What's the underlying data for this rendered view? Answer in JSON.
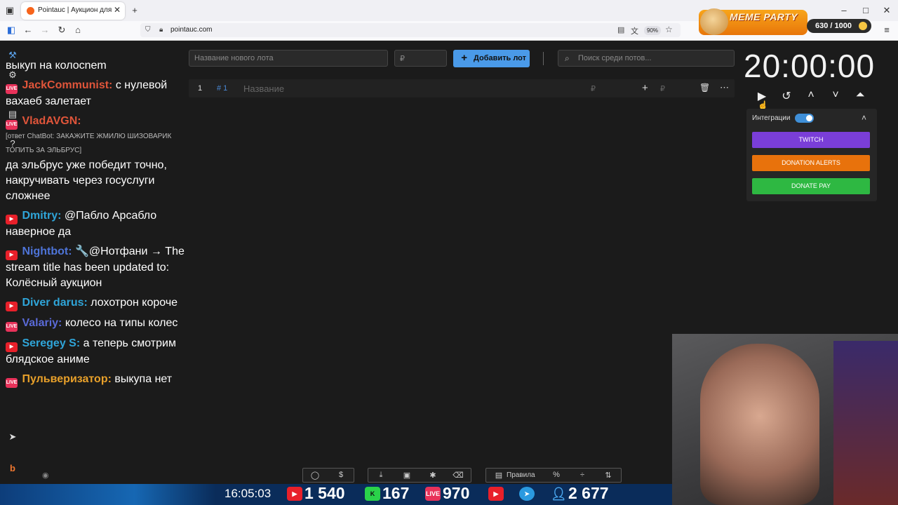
{
  "browser": {
    "tab_title": "Pointauc | Аукцион для стриме",
    "url": "pointauc.com",
    "zoom": "90%"
  },
  "overlay": {
    "meme_title": "MEME PARTY",
    "meme_count": "630 / 1000"
  },
  "chat": {
    "messages": [
      {
        "user": "",
        "text": "выкуп на колосnem"
      },
      {
        "user": "JackCommunist:",
        "text": "с нулевой вахаеб залетает",
        "color": "#e0553a"
      },
      {
        "user": "VladAVGN:",
        "text": "",
        "color": "#e0553a"
      },
      {
        "reply": "[ответ ChatBot: ЗАКАЖИТЕ ЖМИЛЮ ШИЗОВАРИК ТОПИТЬ ЗА ЭЛЬБРУС]"
      },
      {
        "user": "",
        "text": "да эльбрус уже победит точно, накручивать через госуслуги сложнее"
      },
      {
        "user": "Dmitry:",
        "text": "@Пабло Арсабло наверное да",
        "color": "#2fa5d9"
      },
      {
        "user": "Nightbot:",
        "text": "🔧@Нотфани → The stream title has been updated to: Колёсный аукцион",
        "color": "#4e74d8"
      },
      {
        "user": "Diver darus:",
        "text": "лохотрон короче",
        "color": "#2fa5d9"
      },
      {
        "user": "Valariy:",
        "text": "колесо на типы колес",
        "color": "#5a6ad8"
      },
      {
        "user": "Seregey S:",
        "text": "а теперь смотрим блядское аниме",
        "color": "#2fa5d9"
      },
      {
        "user": "Пульверизатор:",
        "text": "выкупа нет",
        "color": "#e8a02a"
      }
    ]
  },
  "lot_form": {
    "name_placeholder": "Название нового лота",
    "amount_placeholder": "₽",
    "add_button": "Добавить лот",
    "search_placeholder": "Поиск среди потов..."
  },
  "lot_row": {
    "index": "1",
    "id": "# 1",
    "name_placeholder": "Название",
    "amount_placeholder": "₽",
    "add_placeholder": "₽"
  },
  "timer": {
    "value": "20:00:00"
  },
  "integrations": {
    "label": "Интеграции",
    "twitch": "TWITCH",
    "donation_alerts": "DONATION ALERTS",
    "donate_pay": "DONATE PAY",
    "colors": {
      "twitch": "#7a3ed8",
      "donation_alerts": "#e8720c",
      "donate_pay": "#2eb842"
    }
  },
  "bottom_toolbar": {
    "rules_label": "Правила"
  },
  "stream_bar": {
    "time": "16:05:03",
    "youtube_viewers": "1 540",
    "kick_viewers": "167",
    "vk_viewers": "970",
    "total_viewers": "2 677"
  }
}
